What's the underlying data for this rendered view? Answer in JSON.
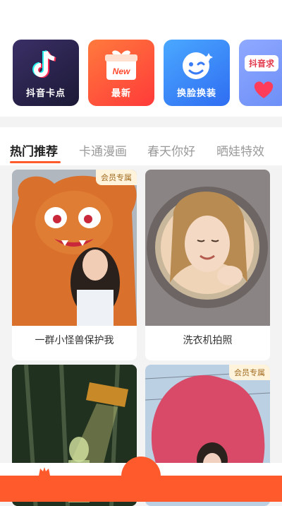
{
  "categories": [
    {
      "label": "抖音卡点",
      "icon": "tiktok-note-icon"
    },
    {
      "label": "最新",
      "icon": "gift-new-icon",
      "badge": "New"
    },
    {
      "label": "换脸换装",
      "icon": "wink-face-icon"
    },
    {
      "label": "",
      "icon": "heart-icon",
      "badge": "抖音求"
    }
  ],
  "tabs": [
    "热门推荐",
    "卡通漫画",
    "春天你好",
    "晒娃特效"
  ],
  "active_tab": 0,
  "cards": [
    {
      "caption": "一群小怪兽保护我",
      "vip": "会员专属"
    },
    {
      "caption": "洗衣机拍照",
      "vip": ""
    },
    {
      "caption": "",
      "vip": ""
    },
    {
      "caption": "",
      "vip": "会员专属"
    }
  ],
  "colors": {
    "accent": "#ff5a2b",
    "vip_bg": "#fff3dc",
    "vip_text": "#a06a1e"
  }
}
